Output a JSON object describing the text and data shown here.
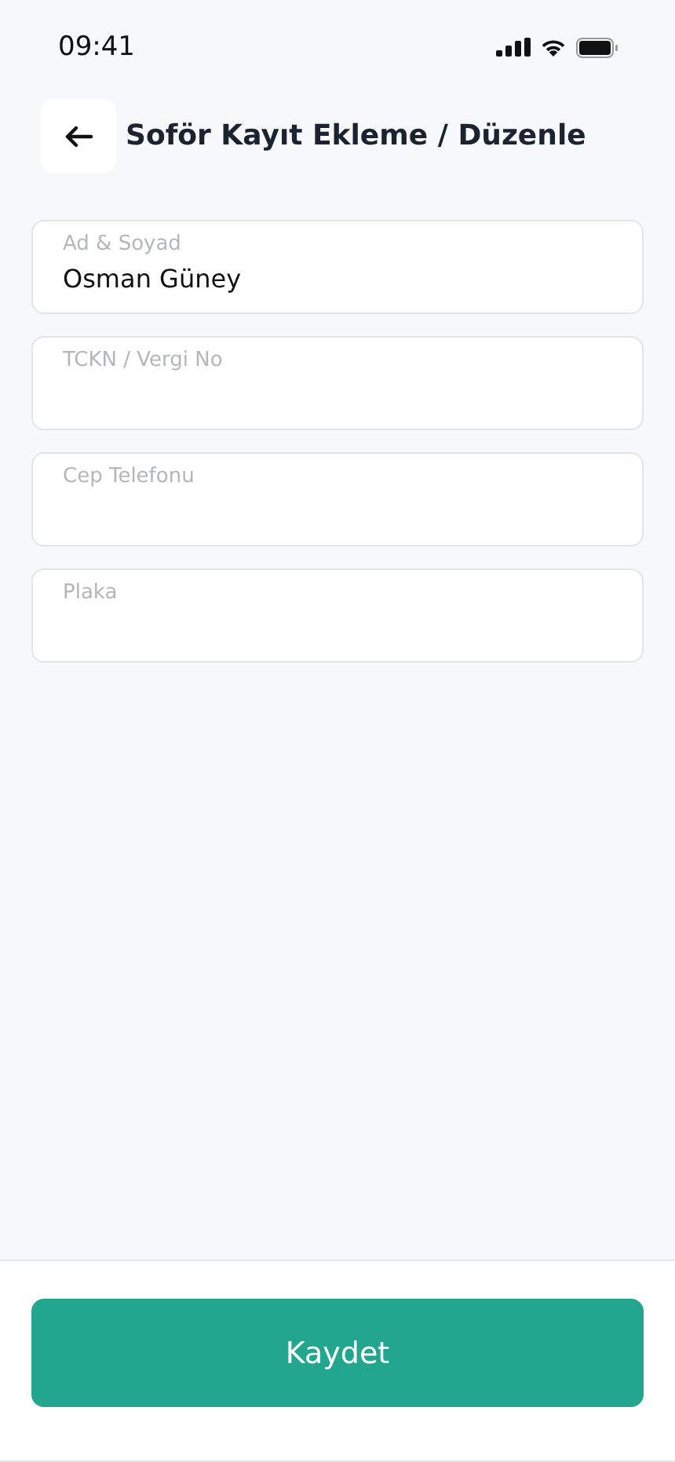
{
  "status_bar": {
    "time": "09:41"
  },
  "header": {
    "title": "Soför Kayıt Ekleme / Düzenle"
  },
  "fields": [
    {
      "label": "Ad & Soyad",
      "value": "Osman Güney"
    },
    {
      "label": "TCKN / Vergi No"
    },
    {
      "label": "Cep Telefonu"
    },
    {
      "label": "Plaka"
    }
  ],
  "save_button": {
    "label": "Kaydet"
  }
}
